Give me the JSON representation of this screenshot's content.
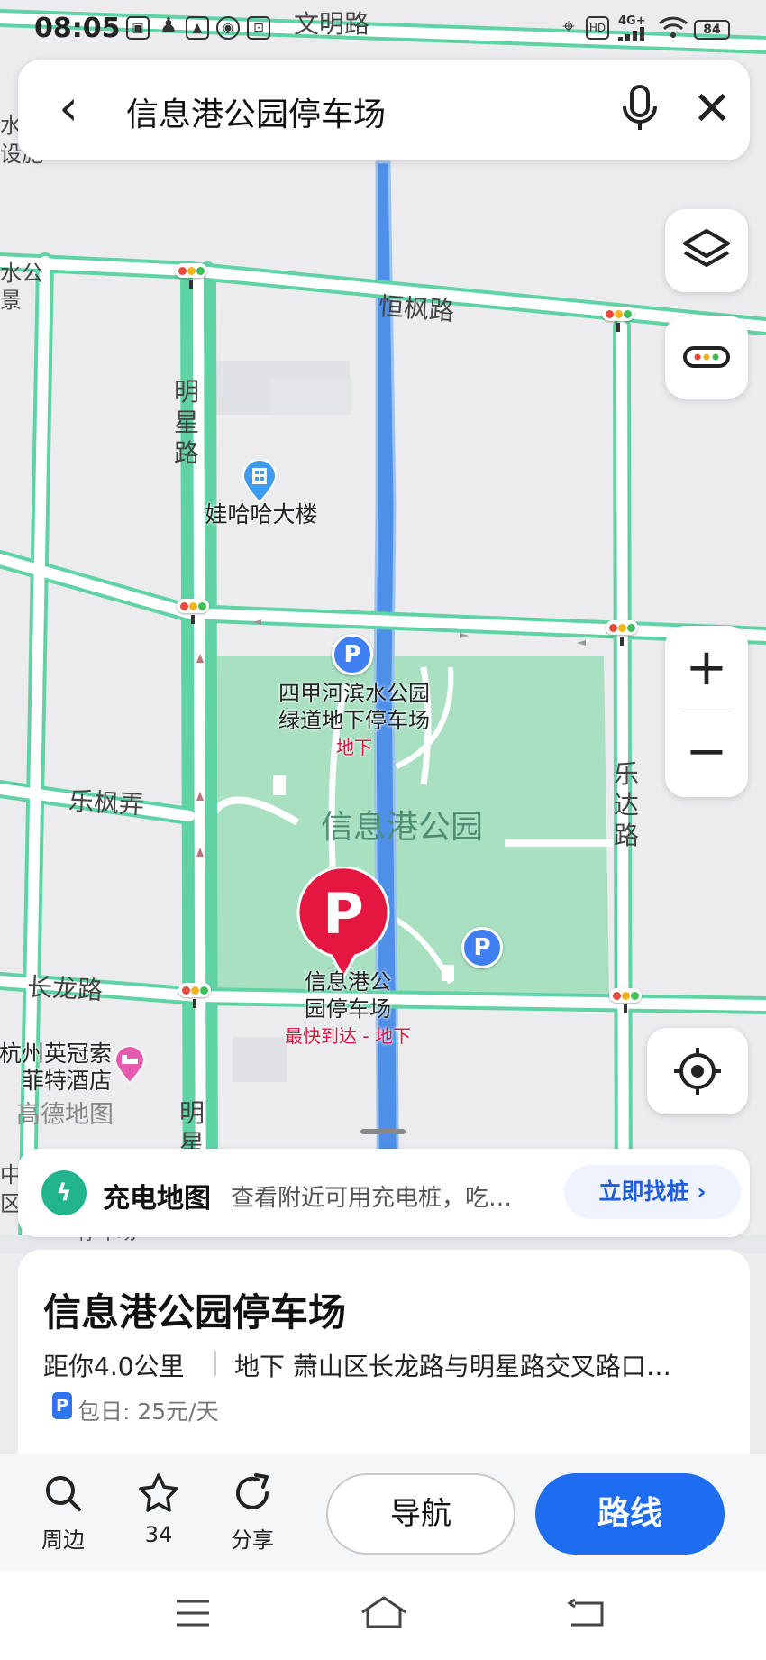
{
  "status_bar": {
    "time": "08:05",
    "network": "4G+",
    "battery": "84",
    "hd": "HD"
  },
  "search": {
    "query": "信息港公园停车场"
  },
  "map": {
    "road_labels": {
      "wenming": "文明路",
      "hengfeng": "恒枫路",
      "mingxing": [
        "明",
        "星",
        "路"
      ],
      "mingxing_bottom": [
        "明",
        "星"
      ],
      "lefeng": "乐枫弄",
      "leda": [
        "乐",
        "达",
        "路"
      ],
      "changlong": "长龙路"
    },
    "park_name": "信息港公园",
    "edge_labels": [
      "水",
      "设施",
      "水公",
      "景",
      "中",
      "区"
    ],
    "pois": {
      "wahaha": "娃哈哈大楼",
      "sijiahe_line1": "四甲河滨水公园",
      "sijiahe_line2": "绿道地下停车场",
      "sijiahe_sub": "地下",
      "selected_line1": "信息港公",
      "selected_line2": "园停车场",
      "selected_sub": "最快到达 - 地下",
      "hotel_line1": "杭州英冠索",
      "hotel_line2": "菲特酒店",
      "parking_pin": "P",
      "behind_sheet_text": "停车场"
    },
    "watermark": "高德地图"
  },
  "charging": {
    "title": "充电地图",
    "desc": "查看附近可用充电桩，吃…",
    "button": "立即找桩"
  },
  "place": {
    "name": "信息港公园停车场",
    "distance": "距你4.0公里",
    "address": "地下 萧山区长龙路与明星路交叉路口…",
    "parking_tag": "P",
    "fee": "包日: 25元/天"
  },
  "actions": {
    "nearby": "周边",
    "favorite_count": "34",
    "share": "分享",
    "navigate": "导航",
    "route": "路线"
  },
  "colors": {
    "road_outline": "#5fd3a4",
    "park": "#a9e0c2",
    "river": "#4e8fe8",
    "selected_pin": "#e5163f",
    "primary": "#1e6cf0"
  }
}
